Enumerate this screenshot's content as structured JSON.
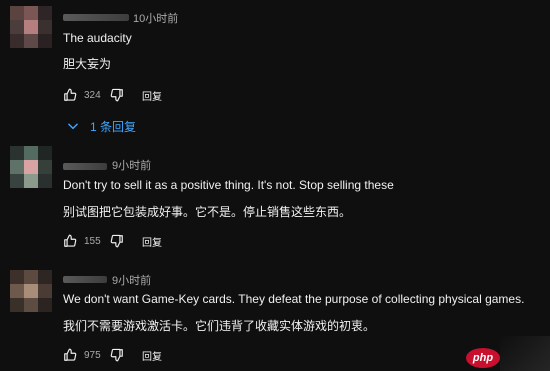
{
  "comments": [
    {
      "time": "10小时前",
      "text_en": "The audacity",
      "text_zh": "胆大妄为",
      "likes": "324",
      "reply_label": "回复",
      "avatar_colors": [
        "#5b4340",
        "#7a5654",
        "#2e2626",
        "#4b3d3c",
        "#b47f7e",
        "#3b3030",
        "#382c2c",
        "#5e4848",
        "#2a2222"
      ]
    },
    {
      "time": "9小时前",
      "text_en": "Don't try to sell it as a positive thing. It's not. Stop selling these",
      "text_zh": "别试图把它包装成好事。它不是。停止销售这些东西。",
      "likes": "155",
      "reply_label": "回复",
      "avatar_colors": [
        "#2a3330",
        "#546b61",
        "#1f2624",
        "#5e7268",
        "#d7a4a3",
        "#344039",
        "#38423e",
        "#8c9a8e",
        "#2a302d"
      ]
    },
    {
      "time": "9小时前",
      "text_en": "We don't want Game-Key cards. They defeat the purpose of collecting physical games.",
      "text_zh": "我们不需要游戏激活卡。它们违背了收藏实体游戏的初衷。",
      "likes": "975",
      "reply_label": "回复",
      "avatar_colors": [
        "#3d302b",
        "#5c4a40",
        "#2d2622",
        "#6e5a4c",
        "#a88d79",
        "#4a3c34",
        "#3a302a",
        "#5d4c42",
        "#2c2420"
      ]
    }
  ],
  "replies_toggle": {
    "label": "1 条回复"
  },
  "watermark": {
    "text": "php"
  }
}
